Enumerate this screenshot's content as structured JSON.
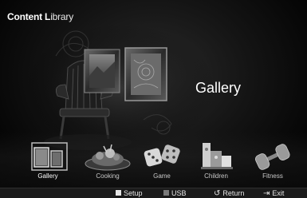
{
  "header": {
    "title_bold": "Content L",
    "title_rest": "ibrary"
  },
  "current_category": "Gallery",
  "categories": [
    {
      "label": "Gallery",
      "icon": "gallery-icon",
      "selected": true
    },
    {
      "label": "Cooking",
      "icon": "cooking-icon",
      "selected": false
    },
    {
      "label": "Game",
      "icon": "dice-icon",
      "selected": false
    },
    {
      "label": "Children",
      "icon": "blocks-icon",
      "selected": false
    },
    {
      "label": "Fitness",
      "icon": "dumbbell-icon",
      "selected": false
    }
  ],
  "footer": {
    "setup": {
      "label": "Setup",
      "color": "#e6e6e6"
    },
    "usb": {
      "label": "USB",
      "color": "#7a7a7a"
    },
    "return": {
      "label": "Return"
    },
    "exit": {
      "label": "Exit"
    }
  }
}
